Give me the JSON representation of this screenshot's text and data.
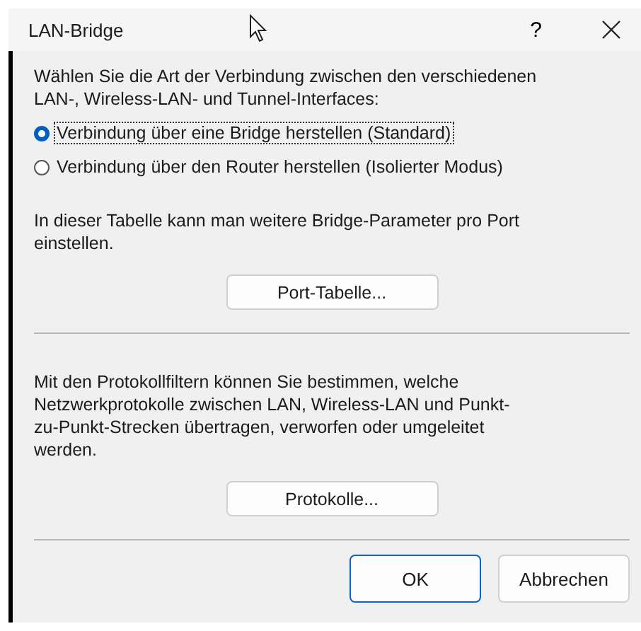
{
  "window": {
    "title": "LAN-Bridge",
    "help": "?"
  },
  "intro": "Wählen Sie die Art der Verbindung zwischen den verschiedenen LAN-, Wireless-LAN- und Tunnel-Interfaces:",
  "options": [
    {
      "label": "Verbindung über eine Bridge herstellen (Standard)",
      "selected": true
    },
    {
      "label": "Verbindung über den Router herstellen (Isolierter Modus)",
      "selected": false
    }
  ],
  "sections": [
    {
      "text": "In dieser Tabelle kann man weitere Bridge-Parameter pro Port einstellen.",
      "button": "Port-Tabelle..."
    },
    {
      "text": "Mit den Protokollfiltern können Sie bestimmen, welche Netzwerkprotokolle zwischen LAN, Wireless-LAN und Punkt-zu-Punkt-Strecken übertragen, verworfen oder umgeleitet werden.",
      "button": "Protokolle..."
    }
  ],
  "buttons": [
    {
      "label": "OK",
      "kind": "default"
    },
    {
      "label": "Abbrechen",
      "kind": "normal"
    }
  ]
}
